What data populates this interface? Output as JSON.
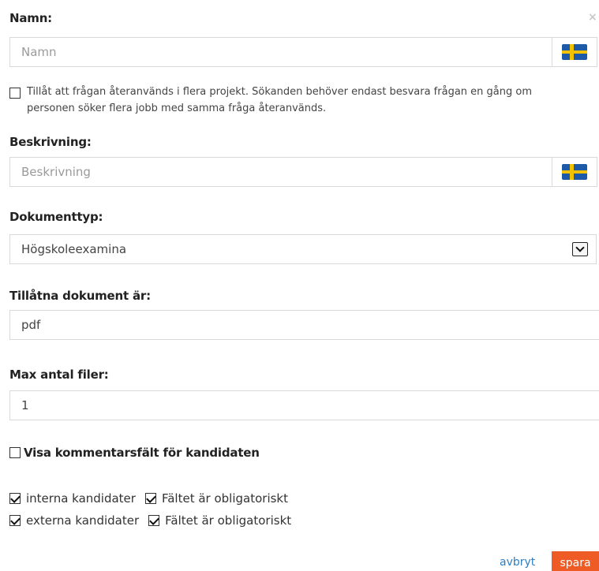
{
  "name_section": {
    "label": "Namn:",
    "placeholder": "Namn",
    "flag_icon": "swedish-flag-icon",
    "close_glyph": "×"
  },
  "reuse": {
    "checked": false,
    "text": "Tillåt att frågan återanvänds i flera projekt. Sökanden behöver endast besvara frågan en gång om personen söker flera jobb med samma fråga återanvänds."
  },
  "description_section": {
    "label": "Beskrivning:",
    "placeholder": "Beskrivning"
  },
  "document_type": {
    "label": "Dokumenttyp:",
    "selected": "Högskoleexamina"
  },
  "allowed_documents": {
    "label": "Tillåtna dokument är:",
    "value": "pdf"
  },
  "max_files": {
    "label": "Max antal filer:",
    "value": "1"
  },
  "comment_field": {
    "checked": false,
    "label": "Visa kommentarsfält för kandidaten"
  },
  "candidates": [
    {
      "checked": true,
      "label": "interna kandidater",
      "required_checked": true,
      "required_label": "Fältet är obligatoriskt"
    },
    {
      "checked": true,
      "label": "externa kandidater",
      "required_checked": true,
      "required_label": "Fältet är obligatoriskt"
    }
  ],
  "actions": {
    "cancel_label": "avbryt",
    "save_label": "spara"
  },
  "colors": {
    "accent": "#ef5b24",
    "link": "#2f7fc2"
  }
}
